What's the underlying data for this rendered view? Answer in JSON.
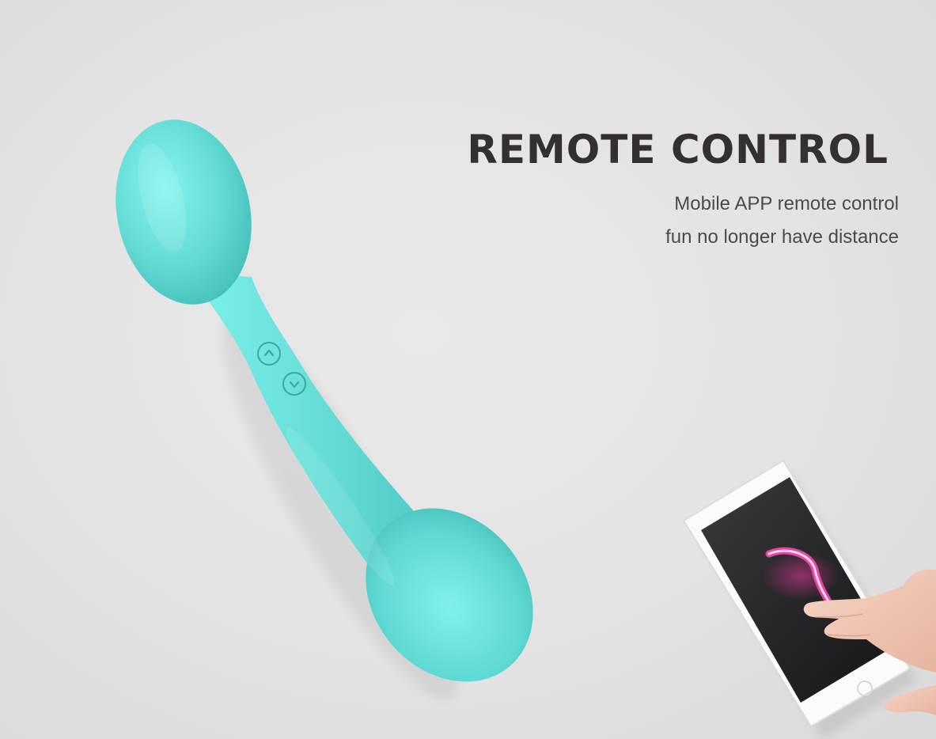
{
  "headline": "REMOTE CONTROL",
  "subtitle": {
    "line1": "Mobile APP remote control",
    "line2": "fun no longer have distance"
  },
  "colors": {
    "background": "#e4e4e4",
    "product": "#63dcd6",
    "headline": "#332f33",
    "subtitle": "#4a4a4a",
    "screen_glow": "#e0208a"
  },
  "icons": {
    "button_up": "chevron-up-icon",
    "button_down": "chevron-down-icon"
  }
}
